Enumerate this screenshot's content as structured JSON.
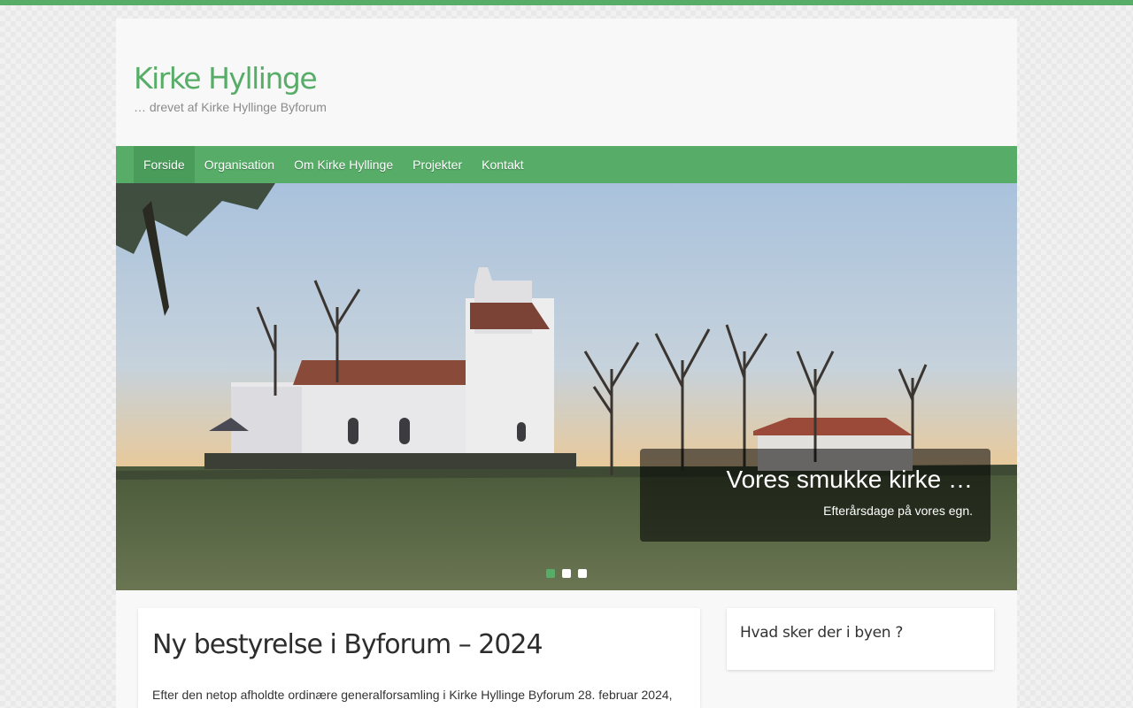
{
  "site": {
    "title": "Kirke Hyllinge",
    "description": "… drevet af Kirke Hyllinge Byforum"
  },
  "nav": {
    "items": [
      {
        "label": "Forside",
        "active": true
      },
      {
        "label": "Organisation",
        "active": false
      },
      {
        "label": "Om Kirke Hyllinge",
        "active": false
      },
      {
        "label": "Projekter",
        "active": false
      },
      {
        "label": "Kontakt",
        "active": false
      }
    ]
  },
  "slider": {
    "caption_title": "Vores smukke kirke …",
    "caption_text": "Efterårsdage på vores egn.",
    "slide_count": 3,
    "active_slide": 1
  },
  "post": {
    "title": "Ny bestyrelse i Byforum – 2024",
    "excerpt": "Efter den netop afholdte ordinære generalforsamling i Kirke Hyllinge Byforum 28. februar 2024,"
  },
  "sidebar": {
    "widget_title": "Hvad sker der i byen ?"
  },
  "colors": {
    "accent": "#57ad68",
    "nav_active": "#4a9c5b",
    "page_bg": "#f8f8f8"
  }
}
